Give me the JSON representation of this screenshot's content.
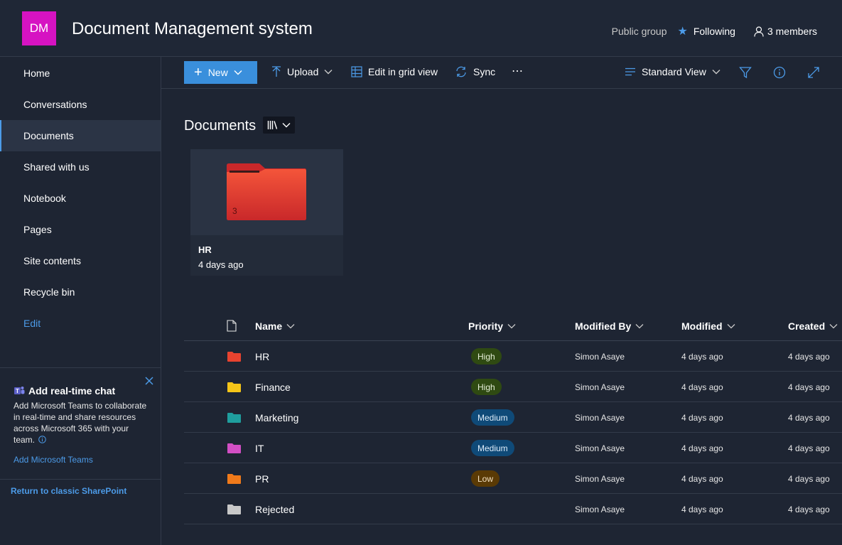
{
  "header": {
    "logo_initials": "DM",
    "logo_color": "#d613c2",
    "site_title": "Document Management system",
    "group_type": "Public group",
    "follow_label": "Following",
    "members_label": "3 members"
  },
  "nav": {
    "items": [
      {
        "label": "Home"
      },
      {
        "label": "Conversations"
      },
      {
        "label": "Documents",
        "active": true
      },
      {
        "label": "Shared with us"
      },
      {
        "label": "Notebook"
      },
      {
        "label": "Pages"
      },
      {
        "label": "Site contents"
      },
      {
        "label": "Recycle bin"
      }
    ],
    "edit_label": "Edit"
  },
  "chat_promo": {
    "title": "Add real-time chat",
    "description": "Add Microsoft Teams to collaborate in real-time and share resources across Microsoft 365 with your team.",
    "link": "Add Microsoft Teams"
  },
  "classic_link": "Return to classic SharePoint",
  "commandbar": {
    "new_label": "New",
    "upload_label": "Upload",
    "grid_label": "Edit in grid view",
    "sync_label": "Sync",
    "more_label": "⋯",
    "view_label": "Standard View"
  },
  "library": {
    "title": "Documents",
    "tile": {
      "name": "HR",
      "date": "4 days ago",
      "count": "3"
    }
  },
  "list": {
    "columns": {
      "name": "Name",
      "priority": "Priority",
      "modified_by": "Modified By",
      "modified": "Modified",
      "created": "Created"
    },
    "rows": [
      {
        "name": "HR",
        "priority": "High",
        "modified_by": "Simon Asaye",
        "modified": "4 days ago",
        "created": "4 days ago",
        "folder_color": "#e8432f"
      },
      {
        "name": "Finance",
        "priority": "High",
        "modified_by": "Simon Asaye",
        "modified": "4 days ago",
        "created": "4 days ago",
        "folder_color": "#f5c518"
      },
      {
        "name": "Marketing",
        "priority": "Medium",
        "modified_by": "Simon Asaye",
        "modified": "4 days ago",
        "created": "4 days ago",
        "folder_color": "#1f9e9e"
      },
      {
        "name": "IT",
        "priority": "Medium",
        "modified_by": "Simon Asaye",
        "modified": "4 days ago",
        "created": "4 days ago",
        "folder_color": "#d24fc4"
      },
      {
        "name": "PR",
        "priority": "Low",
        "modified_by": "Simon Asaye",
        "modified": "4 days ago",
        "created": "4 days ago",
        "folder_color": "#f07a1a"
      },
      {
        "name": "Rejected",
        "priority": "",
        "modified_by": "Simon Asaye",
        "modified": "4 days ago",
        "created": "4 days ago",
        "folder_color": "#c8c8c8"
      }
    ]
  },
  "priority_colors": {
    "High": {
      "bg": "#2f4a12",
      "fg": "#e6f0d8"
    },
    "Medium": {
      "bg": "#0f4a78",
      "fg": "#e0eefb"
    },
    "Low": {
      "bg": "#5a3a05",
      "fg": "#f5e3c4"
    }
  }
}
